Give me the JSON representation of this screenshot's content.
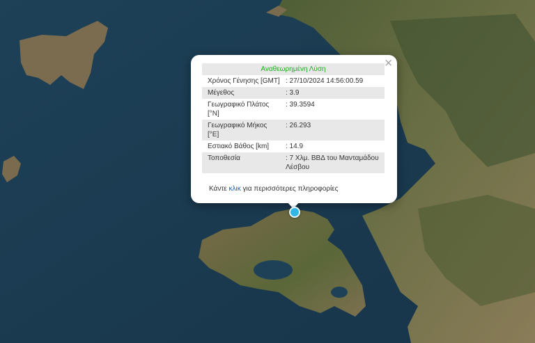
{
  "popup": {
    "header": "Αναθεωρημένη Λύση",
    "close_label": "×",
    "rows": [
      {
        "label": "Χρόνος Γένησης [GMT]",
        "value": ": 27/10/2024 14:56:00.59"
      },
      {
        "label": "Μέγεθος",
        "value": ": 3.9"
      },
      {
        "label": "Γεωγραφικό Πλάτος [°N]",
        "value": ": 39.3594"
      },
      {
        "label": "Γεωγραφικό Μήκος [°E]",
        "value": ": 26.293"
      },
      {
        "label": "Εστιακό Βάθος [km]",
        "value": ": 14.9"
      },
      {
        "label": "Τοποθεσία",
        "value": ": 7 Χλμ. ΒΒΔ του Μανταμάδου Λέσβου"
      }
    ],
    "more_prefix": "Κάντε ",
    "more_link": "κλικ",
    "more_suffix": " για περισσότερες πληροφορίες"
  },
  "colors": {
    "sea": "#1b3a4f",
    "land": "#5d6b3f",
    "marker": "#31b7e6",
    "header_text": "#22aa22",
    "link": "#1a5fb4"
  }
}
